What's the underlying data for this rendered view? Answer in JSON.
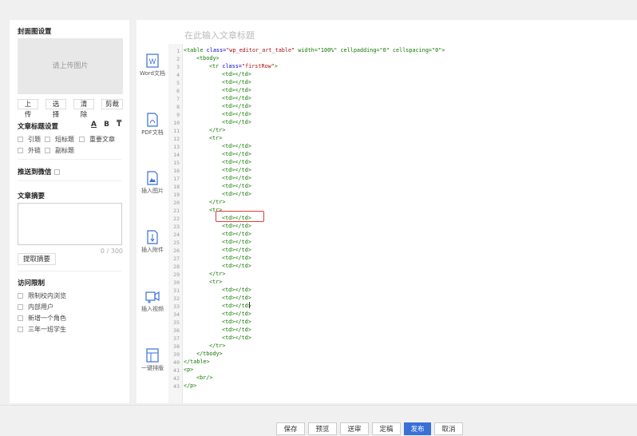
{
  "left": {
    "cover_title": "封面图设置",
    "upload_placeholder": "请上传图片",
    "cover_buttons": [
      "上传",
      "选择",
      "清除",
      "剪裁"
    ],
    "title_settings": "文章标题设置",
    "title_tools": [
      "A",
      "B",
      "T"
    ],
    "title_options": [
      "引题",
      "短标题",
      "重要文章",
      "外链",
      "副标题"
    ],
    "wechat": "推送到微信",
    "summary": "文章摘要",
    "summary_count": "0 / 300",
    "extract_button": "提取摘要",
    "access": "访问限制",
    "access_options": [
      "限制校内浏览",
      "内部用户",
      "新增一个角色",
      "三年一班学生"
    ]
  },
  "tools": [
    "Word文档",
    "PDF文档",
    "插入图片",
    "插入附件",
    "插入视频",
    "一键排版"
  ],
  "editor": {
    "title_placeholder": "在此输入文章标题",
    "lines": [
      {
        "n": "1",
        "indent": 0,
        "tag": "<table ",
        "attr": "class=",
        "val": "\"wp_editor_art_table\"",
        "rest": " width=\"100%\" cellpadding=\"0\" cellspacing=\"0\">"
      },
      {
        "n": "2",
        "indent": 1,
        "tag": "<tbody>"
      },
      {
        "n": "3",
        "indent": 2,
        "tag": "<tr ",
        "attr": "class=",
        "val": "\"firstRow\"",
        "rest": ">"
      },
      {
        "n": "4",
        "indent": 3,
        "tag": "<td></td>"
      },
      {
        "n": "5",
        "indent": 3,
        "tag": "<td></td>"
      },
      {
        "n": "6",
        "indent": 3,
        "tag": "<td></td>"
      },
      {
        "n": "7",
        "indent": 3,
        "tag": "<td></td>"
      },
      {
        "n": "8",
        "indent": 3,
        "tag": "<td></td>"
      },
      {
        "n": "9",
        "indent": 3,
        "tag": "<td></td>"
      },
      {
        "n": "10",
        "indent": 3,
        "tag": "<td></td>"
      },
      {
        "n": "11",
        "indent": 2,
        "tag": "</tr>"
      },
      {
        "n": "12",
        "indent": 2,
        "tag": "<tr>"
      },
      {
        "n": "13",
        "indent": 3,
        "tag": "<td></td>"
      },
      {
        "n": "14",
        "indent": 3,
        "tag": "<td></td>"
      },
      {
        "n": "15",
        "indent": 3,
        "tag": "<td></td>"
      },
      {
        "n": "16",
        "indent": 3,
        "tag": "<td></td>"
      },
      {
        "n": "17",
        "indent": 3,
        "tag": "<td></td>"
      },
      {
        "n": "18",
        "indent": 3,
        "tag": "<td></td>"
      },
      {
        "n": "19",
        "indent": 3,
        "tag": "<td></td>"
      },
      {
        "n": "20",
        "indent": 2,
        "tag": "</tr>"
      },
      {
        "n": "21",
        "indent": 2,
        "tag": "<tr>"
      },
      {
        "n": "22",
        "indent": 3,
        "tag": "<td></td>"
      },
      {
        "n": "23",
        "indent": 3,
        "tag": "<td></td>"
      },
      {
        "n": "24",
        "indent": 3,
        "tag": "<td></td>"
      },
      {
        "n": "25",
        "indent": 3,
        "tag": "<td></td>"
      },
      {
        "n": "26",
        "indent": 3,
        "tag": "<td></td>"
      },
      {
        "n": "27",
        "indent": 3,
        "tag": "<td></td>"
      },
      {
        "n": "28",
        "indent": 3,
        "tag": "<td></td>"
      },
      {
        "n": "29",
        "indent": 2,
        "tag": "</tr>"
      },
      {
        "n": "30",
        "indent": 2,
        "tag": "<tr>"
      },
      {
        "n": "31",
        "indent": 3,
        "tag": "<td></td>"
      },
      {
        "n": "32",
        "indent": 3,
        "tag": "<td></td>"
      },
      {
        "n": "33",
        "indent": 3,
        "tag": "<td></td>"
      },
      {
        "n": "34",
        "indent": 3,
        "tag": "<td></td>"
      },
      {
        "n": "35",
        "indent": 3,
        "tag": "<td></td>"
      },
      {
        "n": "36",
        "indent": 3,
        "tag": "<td></td>"
      },
      {
        "n": "37",
        "indent": 3,
        "tag": "<td></td>"
      },
      {
        "n": "38",
        "indent": 2,
        "tag": "</tr>"
      },
      {
        "n": "39",
        "indent": 1,
        "tag": "</tbody>"
      },
      {
        "n": "40",
        "indent": 0,
        "tag": "</table>"
      },
      {
        "n": "41",
        "indent": 0,
        "tag": "<p>"
      },
      {
        "n": "42",
        "indent": 1,
        "tag": "<br/>"
      },
      {
        "n": "43",
        "indent": 0,
        "tag": "</p>"
      }
    ]
  },
  "bottom_buttons": [
    "保存",
    "预览",
    "送审",
    "定稿",
    "发布",
    "取消"
  ],
  "colors": {
    "primary": "#3a6fd8",
    "highlight": "#e23b3b",
    "code_green": "#117700"
  }
}
